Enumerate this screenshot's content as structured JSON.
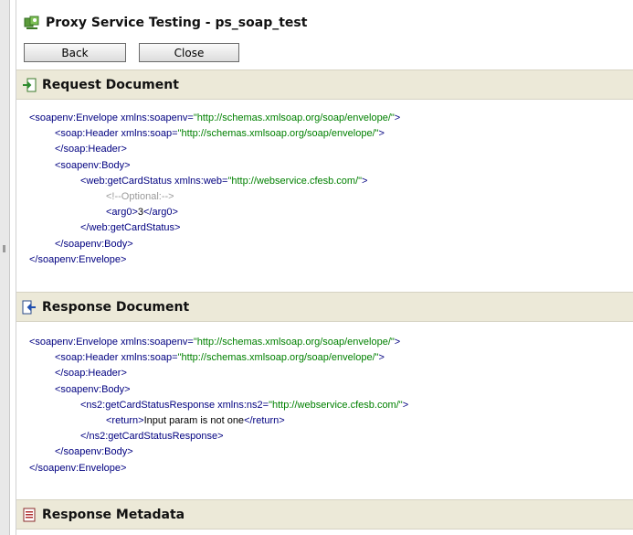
{
  "window": {
    "title": "Proxy Service Testing - ps_soap_test"
  },
  "toolbar": {
    "back_label": "Back",
    "close_label": "Close"
  },
  "request": {
    "heading": "Request Document",
    "lines": [
      {
        "indent": 0,
        "parts": [
          [
            "tag",
            "<soapenv:Envelope "
          ],
          [
            "attr",
            "xmlns:soapenv"
          ],
          [
            "tag",
            "="
          ],
          [
            "val",
            "\"http://schemas.xmlsoap.org/soap/envelope/\""
          ],
          [
            "tag",
            ">"
          ]
        ]
      },
      {
        "indent": 1,
        "parts": [
          [
            "tag",
            "<soap:Header "
          ],
          [
            "attr",
            "xmlns:soap"
          ],
          [
            "tag",
            "="
          ],
          [
            "val",
            "\"http://schemas.xmlsoap.org/soap/envelope/\""
          ],
          [
            "tag",
            ">"
          ]
        ]
      },
      {
        "indent": 1,
        "parts": [
          [
            "tag",
            "</soap:Header>"
          ]
        ]
      },
      {
        "indent": 1,
        "parts": [
          [
            "tag",
            "<soapenv:Body>"
          ]
        ]
      },
      {
        "indent": 2,
        "parts": [
          [
            "tag",
            "<web:getCardStatus "
          ],
          [
            "attr",
            "xmlns:web"
          ],
          [
            "tag",
            "="
          ],
          [
            "val",
            "\"http://webservice.cfesb.com/\""
          ],
          [
            "tag",
            ">"
          ]
        ]
      },
      {
        "indent": 3,
        "parts": [
          [
            "cmt",
            "<!--Optional:-->"
          ]
        ]
      },
      {
        "indent": 3,
        "parts": [
          [
            "tag",
            "<arg0>"
          ],
          [
            "txt",
            "3"
          ],
          [
            "tag",
            "</arg0>"
          ]
        ]
      },
      {
        "indent": 2,
        "parts": [
          [
            "tag",
            "</web:getCardStatus>"
          ]
        ]
      },
      {
        "indent": 1,
        "parts": [
          [
            "tag",
            "</soapenv:Body>"
          ]
        ]
      },
      {
        "indent": 0,
        "parts": [
          [
            "tag",
            "</soapenv:Envelope>"
          ]
        ]
      }
    ]
  },
  "response": {
    "heading": "Response Document",
    "lines": [
      {
        "indent": 0,
        "parts": [
          [
            "tag",
            "<soapenv:Envelope "
          ],
          [
            "attr",
            "xmlns:soapenv"
          ],
          [
            "tag",
            "="
          ],
          [
            "val",
            "\"http://schemas.xmlsoap.org/soap/envelope/\""
          ],
          [
            "tag",
            ">"
          ]
        ]
      },
      {
        "indent": 1,
        "parts": [
          [
            "tag",
            "<soap:Header "
          ],
          [
            "attr",
            "xmlns:soap"
          ],
          [
            "tag",
            "="
          ],
          [
            "val",
            "\"http://schemas.xmlsoap.org/soap/envelope/\""
          ],
          [
            "tag",
            ">"
          ]
        ]
      },
      {
        "indent": 1,
        "parts": [
          [
            "tag",
            "</soap:Header>"
          ]
        ]
      },
      {
        "indent": 1,
        "parts": [
          [
            "tag",
            "<soapenv:Body>"
          ]
        ]
      },
      {
        "indent": 2,
        "parts": [
          [
            "tag",
            "<ns2:getCardStatusResponse "
          ],
          [
            "attr",
            "xmlns:ns2"
          ],
          [
            "tag",
            "="
          ],
          [
            "val",
            "\"http://webservice.cfesb.com/\""
          ],
          [
            "tag",
            ">"
          ]
        ]
      },
      {
        "indent": 3,
        "parts": [
          [
            "tag",
            "<return>"
          ],
          [
            "txt",
            "Input param is not one"
          ],
          [
            "tag",
            "</return>"
          ]
        ]
      },
      {
        "indent": 2,
        "parts": [
          [
            "tag",
            "</ns2:getCardStatusResponse>"
          ]
        ]
      },
      {
        "indent": 1,
        "parts": [
          [
            "tag",
            "</soapenv:Body>"
          ]
        ]
      },
      {
        "indent": 0,
        "parts": [
          [
            "tag",
            "</soapenv:Envelope>"
          ]
        ]
      }
    ]
  },
  "metadata": {
    "heading": "Response Metadata"
  },
  "icons": {
    "title": "test-console-icon",
    "request": "request-arrow-icon",
    "response": "response-arrow-icon",
    "metadata": "metadata-list-icon"
  },
  "colors": {
    "section_bg": "#ece9d8",
    "tag": "#000080",
    "value": "#008000",
    "comment": "#9a9a9a"
  }
}
